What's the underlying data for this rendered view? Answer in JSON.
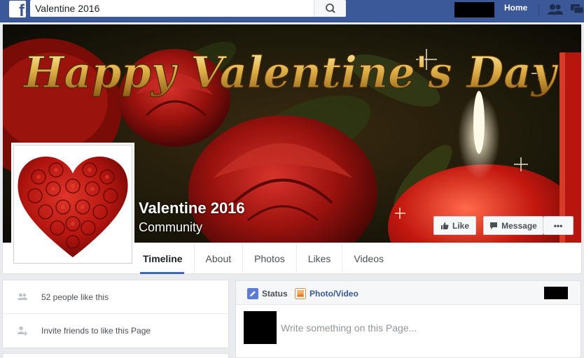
{
  "topbar": {
    "logo_letter": "f",
    "search": {
      "value": "Valentine 2016",
      "placeholder": "Search"
    },
    "home_label": "Home",
    "colors": {
      "bar": "#3b5998",
      "accent": "#4267b2"
    }
  },
  "cover": {
    "banner_text": "Happy Valentine's Day",
    "page_name": "Valentine 2016",
    "page_category": "Community",
    "buttons": {
      "like": "Like",
      "message": "Message",
      "more": "•••"
    }
  },
  "tabs": [
    {
      "label": "Timeline",
      "active": true
    },
    {
      "label": "About"
    },
    {
      "label": "Photos"
    },
    {
      "label": "Likes"
    },
    {
      "label": "Videos"
    }
  ],
  "left": {
    "likes_text": "52 people like this",
    "invite_text": "Invite friends to like this Page"
  },
  "composer": {
    "status_label": "Status",
    "photo_label": "Photo/Video",
    "placeholder": "Write something on this Page..."
  }
}
